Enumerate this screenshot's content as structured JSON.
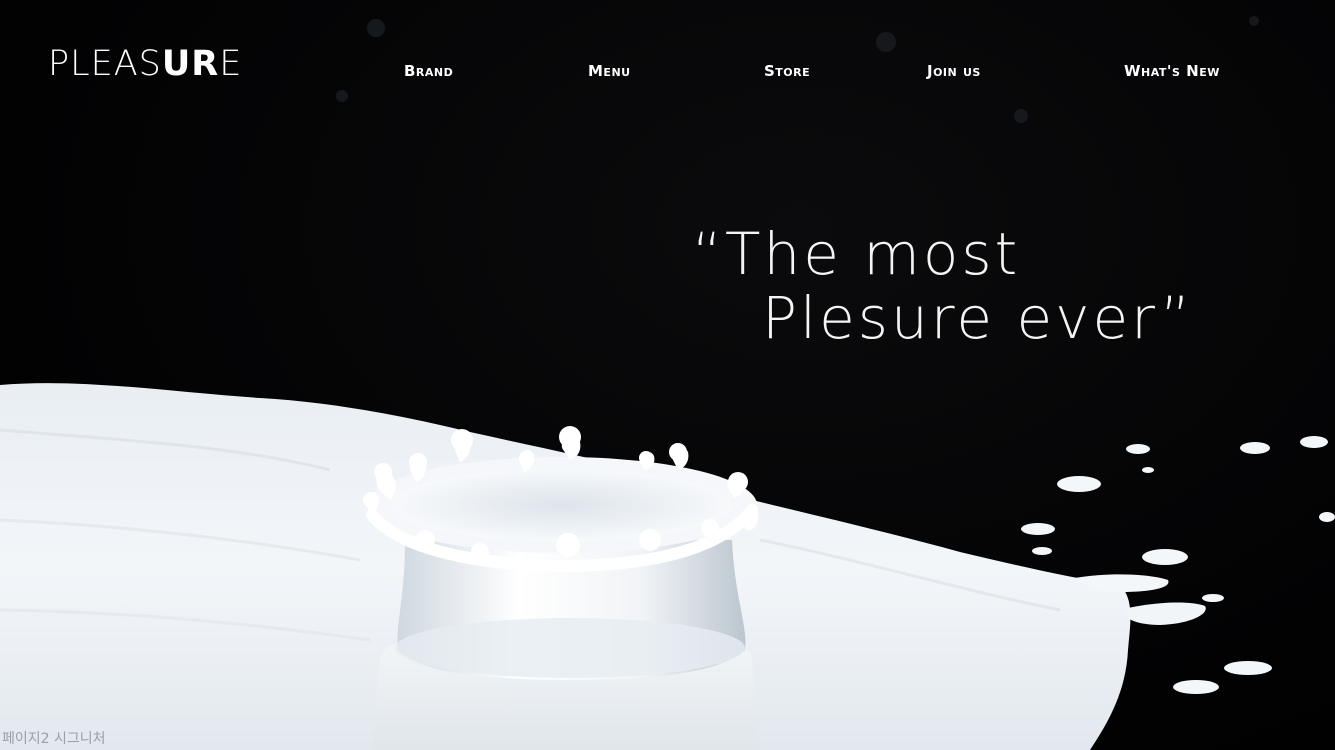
{
  "brand": {
    "logo_light": "PLEAS",
    "logo_bold": "UR",
    "logo_tail": "E"
  },
  "nav": {
    "items": [
      {
        "label": "Brand"
      },
      {
        "label": "Menu"
      },
      {
        "label": "Store"
      },
      {
        "label": "Join us"
      },
      {
        "label": "What's New"
      }
    ]
  },
  "hero": {
    "tagline_line1": "“The most",
    "tagline_line2": "Plesure ever”",
    "image": "milk-splash-crown-photo"
  },
  "footer": {
    "caption": "페이지2 시그니처"
  },
  "colors": {
    "background": "#000000",
    "text": "#ffffff",
    "milk": "#eef3f7",
    "caption": "#9aa0a6"
  }
}
